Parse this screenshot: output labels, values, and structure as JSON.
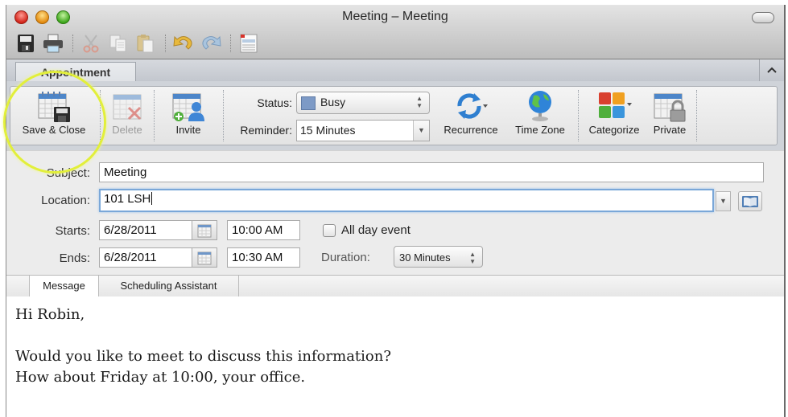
{
  "window": {
    "title": "Meeting – Meeting"
  },
  "toolbar": {
    "icons": [
      "save-icon",
      "print-icon",
      "cut-icon",
      "copy-icon",
      "paste-icon",
      "undo-icon",
      "redo-icon",
      "form-icon"
    ]
  },
  "ribbon": {
    "tab_label": "Appointment",
    "collapse_glyph": "^",
    "buttons": {
      "save_close": "Save & Close",
      "delete": "Delete",
      "invite": "Invite",
      "recurrence": "Recurrence",
      "time_zone": "Time Zone",
      "categorize": "Categorize",
      "private": "Private"
    },
    "status": {
      "label": "Status:",
      "value": "Busy",
      "swatch_color": "#7d9ac6"
    },
    "reminder": {
      "label": "Reminder:",
      "value": "15 Minutes"
    },
    "highlight_color": "#e2ef3a"
  },
  "form": {
    "subject": {
      "label": "Subject:",
      "value": "Meeting"
    },
    "location": {
      "label": "Location:",
      "value": "101 LSH"
    },
    "starts": {
      "label": "Starts:",
      "date": "6/28/2011",
      "time": "10:00 AM"
    },
    "ends": {
      "label": "Ends:",
      "date": "6/28/2011",
      "time": "10:30 AM"
    },
    "all_day": {
      "label": "All day event",
      "checked": false
    },
    "duration": {
      "label": "Duration:",
      "value": "30 Minutes"
    }
  },
  "lower_tabs": [
    {
      "label": "Message",
      "active": true
    },
    {
      "label": "Scheduling Assistant",
      "active": false
    }
  ],
  "message": {
    "lines": [
      "Hi Robin,",
      "",
      "Would you like to meet to discuss this information?",
      "How about Friday at 10:00, your office."
    ]
  }
}
